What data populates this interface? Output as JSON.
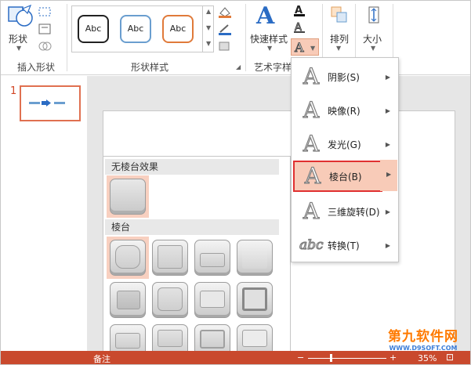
{
  "ribbon": {
    "shapes_label": "形状",
    "insert_shapes_group": "插入形状",
    "shape_styles_group": "形状样式",
    "style_samples": [
      "Abc",
      "Abc",
      "Abc"
    ],
    "quick_styles_label": "快速样式",
    "art_text_group": "艺术字样",
    "arrange_label": "排列",
    "size_label": "大小",
    "colors": {
      "style1": "#222222",
      "style2": "#6a9ecf",
      "style3": "#e07a3a",
      "accent": "#2b6cc4"
    }
  },
  "slides": {
    "number": "1"
  },
  "menu": {
    "items": [
      {
        "label": "阴影(S)",
        "icon": "shadow-A-icon"
      },
      {
        "label": "映像(R)",
        "icon": "reflection-A-icon"
      },
      {
        "label": "发光(G)",
        "icon": "glow-A-icon"
      },
      {
        "label": "棱台(B)",
        "icon": "bevel-A-icon"
      },
      {
        "label": "三维旋转(D)",
        "icon": "rotation-3d-A-icon"
      },
      {
        "label": "转换(T)",
        "icon": "transform-abc-icon"
      }
    ],
    "active_index": 3
  },
  "bevel_panel": {
    "no_bevel_heading": "无棱台效果",
    "bevel_heading": "棱台"
  },
  "status": {
    "zoom": "35%",
    "left_text": "备注"
  },
  "watermark": {
    "main": "第九软件网",
    "sub": "WWW.D9SOFT.COM"
  }
}
